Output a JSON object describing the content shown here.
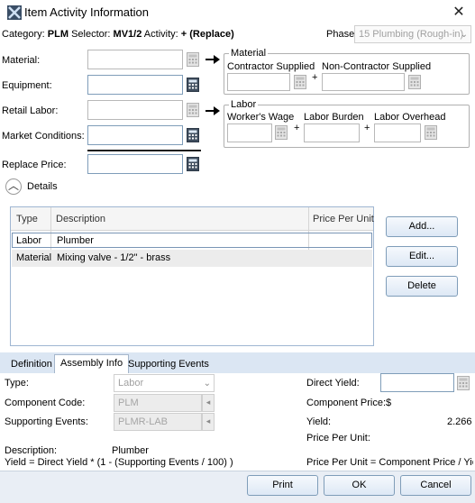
{
  "window": {
    "title": "Item Activity Information",
    "close_glyph": "✕",
    "app_icon": "app-logo-icon"
  },
  "header": {
    "category_label": "Category:",
    "category_value": "PLM",
    "selector_label": "Selector:",
    "selector_value": "MV1/2",
    "activity_label": "Activity:",
    "activity_value": "+ (Replace)",
    "phase_label": "Phase:",
    "phase_value": "15 Plumbing (Rough-in)"
  },
  "fields": {
    "material": "Material:",
    "equipment": "Equipment:",
    "retail_labor": "Retail Labor:",
    "market_conditions": "Market Conditions:",
    "replace_price": "Replace Price:"
  },
  "material_group": {
    "legend": "Material",
    "contractor": "Contractor Supplied",
    "non_contractor": "Non-Contractor Supplied",
    "plus": "+"
  },
  "labor_group": {
    "legend": "Labor",
    "wage": "Worker's Wage",
    "burden": "Labor Burden",
    "overhead": "Labor Overhead",
    "plus1": "+",
    "plus2": "+"
  },
  "details": {
    "label": "Details",
    "toggle_glyph": "︿"
  },
  "grid": {
    "columns": [
      "Type",
      "Description",
      "Price Per Unit"
    ],
    "rows": [
      {
        "type": "Labor",
        "description": "Plumber",
        "price": ""
      },
      {
        "type": "Material",
        "description": "Mixing valve - 1/2\" - brass",
        "price": ""
      }
    ]
  },
  "grid_buttons": {
    "add": "Add...",
    "edit": "Edit...",
    "delete": "Delete"
  },
  "tabs": [
    "Definition",
    "Assembly Info",
    "Supporting Events"
  ],
  "assembly": {
    "type_label": "Type:",
    "type_value": "Labor",
    "component_code_label": "Component Code:",
    "component_code_value": "PLM",
    "supporting_events_label": "Supporting Events:",
    "supporting_events_value": "PLMR-LAB",
    "description_label": "Description:",
    "description_value": "Plumber",
    "formula_left": "Yield = Direct Yield * (1 - (Supporting Events / 100) )",
    "direct_yield_label": "Direct Yield:",
    "component_price_label": "Component Price:$",
    "yield_label": "Yield:",
    "yield_value": "2.266",
    "ppu_label": "Price Per Unit:",
    "formula_right": "Price Per Unit = Component Price / Yield"
  },
  "footer": {
    "print": "Print",
    "ok": "OK",
    "cancel": "Cancel"
  },
  "colors": {
    "accent_border": "#7f9db9",
    "tab_strip": "#dbe6f3",
    "grid_border": "#9fb6d2"
  }
}
